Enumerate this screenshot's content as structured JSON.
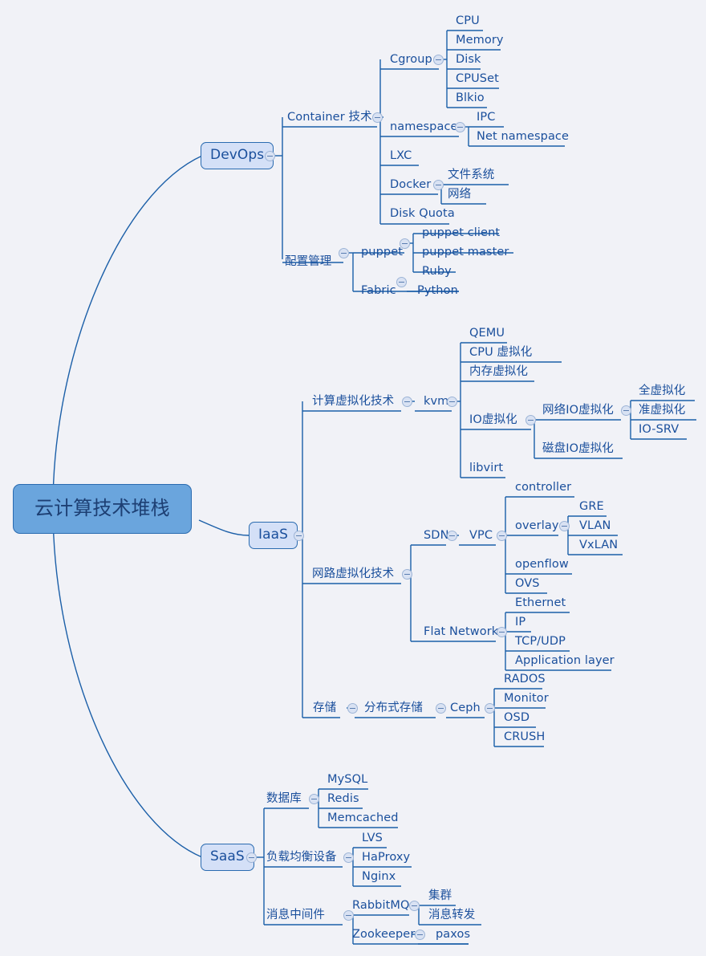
{
  "meta": {
    "background": "#f1f2f7",
    "line_color": "#1b5fa8",
    "text_color": "#1a4f9c",
    "root_fill": "#6aa5dd",
    "branch_fill": "#d4e0f7",
    "border_color": "#2a6bb0"
  },
  "root": {
    "label": "云计算技术堆栈"
  },
  "branches": [
    {
      "label": "DevOps"
    },
    {
      "label": "IaaS"
    },
    {
      "label": "SaaS"
    }
  ],
  "nodes": {
    "container_tech": "Container 技术",
    "cgroup": "Cgroup",
    "cpu": "CPU",
    "memory": "Memory",
    "disk": "Disk",
    "cpuset": "CPUSet",
    "blkio": "Blkio",
    "namespace": "namespace",
    "ipc": "IPC",
    "net_namespace": "Net namespace",
    "lxc": "LXC",
    "docker": "Docker",
    "filesystem": "文件系统",
    "network_cn": "网络",
    "disk_quota": "Disk Quota",
    "config_mgmt": "配置管理",
    "puppet": "puppet",
    "puppet_client": "puppet client",
    "puppet_master": "puppet master",
    "ruby": "Ruby",
    "fabric": "Fabric",
    "python": "Python",
    "compute_virt": "计算虚拟化技术",
    "kvm": "kvm",
    "qemu": "QEMU",
    "cpu_virt": "CPU 虚拟化",
    "mem_virt": "内存虚拟化",
    "io_virt": "IO虚拟化",
    "net_io_virt": "网络IO虚拟化",
    "full_virt": "全虚拟化",
    "para_virt": "准虚拟化",
    "io_srv": "IO-SRV",
    "disk_io_virt": "磁盘IO虚拟化",
    "libvirt": "libvirt",
    "net_virt": "网路虚拟化技术",
    "sdn": "SDN",
    "vpc": "VPC",
    "controller": "controller",
    "overlay": "overlay",
    "gre": "GRE",
    "vlan": "VLAN",
    "vxlan": "VxLAN",
    "openflow": "openflow",
    "ovs": "OVS",
    "flat_network": "Flat Network",
    "ethernet": "Ethernet",
    "ip": "IP",
    "tcp_udp": "TCP/UDP",
    "application_layer": "Application layer",
    "storage": "存储",
    "distributed_storage": "分布式存储",
    "ceph": "Ceph",
    "rados": "RADOS",
    "monitor": "Monitor",
    "osd": "OSD",
    "crush": "CRUSH",
    "database": "数据库",
    "mysql": "MySQL",
    "redis": "Redis",
    "memcached": "Memcached",
    "load_balancer": "负载均衡设备",
    "lvs": "LVS",
    "haproxy": "HaProxy",
    "nginx": "Nginx",
    "message_middleware": "消息中间件",
    "rabbitmq": "RabbitMQ",
    "cluster_cn": "集群",
    "msg_forward": "消息转发",
    "zookeeper": "Zookeeper",
    "paxos": "paxos"
  }
}
